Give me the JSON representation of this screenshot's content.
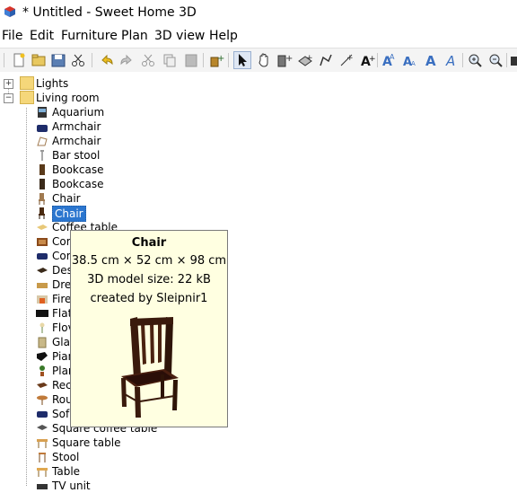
{
  "window": {
    "title": "* Untitled - Sweet Home 3D"
  },
  "menu": [
    "File",
    "Edit",
    "Furniture",
    "Plan",
    "3D view",
    "Help"
  ],
  "toolbar": {
    "icons": [
      "new-home-icon",
      "open-icon",
      "save-icon",
      "cut-tool-icon",
      "undo-icon",
      "redo-icon",
      "cut-icon",
      "copy-icon",
      "paste-icon",
      "add-furniture-icon",
      "select-mode-icon",
      "pan-mode-icon",
      "create-walls-icon",
      "create-rooms-icon",
      "create-polylines-icon",
      "create-dimensions-icon",
      "add-text-icon",
      "increase-text-size-icon",
      "decrease-text-size-icon",
      "bold-text-icon",
      "italic-text-icon",
      "zoom-in-icon",
      "zoom-out-icon",
      "create-photo-icon"
    ]
  },
  "tree": {
    "categories": [
      {
        "label": "Lights",
        "expanded": false
      },
      {
        "label": "Living room",
        "expanded": true
      }
    ],
    "items": [
      {
        "label": "Aquarium",
        "icon": "aquarium-icon"
      },
      {
        "label": "Armchair",
        "icon": "armchair-icon"
      },
      {
        "label": "Armchair",
        "icon": "armchair-icon"
      },
      {
        "label": "Bar stool",
        "icon": "bar-stool-icon"
      },
      {
        "label": "Bookcase",
        "icon": "bookcase-icon"
      },
      {
        "label": "Bookcase",
        "icon": "bookcase-icon"
      },
      {
        "label": "Chair",
        "icon": "chair-icon"
      },
      {
        "label": "Chair",
        "icon": "chair-icon",
        "selected": true
      },
      {
        "label": "Coffee table",
        "icon": "coffee-table-icon"
      },
      {
        "label": "Cor",
        "icon": "corner-icon"
      },
      {
        "label": "Cor",
        "icon": "corner-sofa-icon"
      },
      {
        "label": "Des",
        "icon": "desk-icon"
      },
      {
        "label": "Dre",
        "icon": "dresser-icon"
      },
      {
        "label": "Fire",
        "icon": "fireplace-icon"
      },
      {
        "label": "Flat",
        "icon": "flat-tv-icon"
      },
      {
        "label": "Flov",
        "icon": "flower-icon"
      },
      {
        "label": "Gla",
        "icon": "glass-icon"
      },
      {
        "label": "Pian",
        "icon": "piano-icon"
      },
      {
        "label": "Plan",
        "icon": "plant-icon"
      },
      {
        "label": "Rec",
        "icon": "rectangular-table-icon"
      },
      {
        "label": "Rou",
        "icon": "round-table-icon"
      },
      {
        "label": "Sof",
        "icon": "sofa-icon"
      },
      {
        "label": "Square coffee table",
        "icon": "square-coffee-table-icon"
      },
      {
        "label": "Square table",
        "icon": "square-table-icon"
      },
      {
        "label": "Stool",
        "icon": "stool-icon"
      },
      {
        "label": "Table",
        "icon": "table-icon"
      },
      {
        "label": "TV unit",
        "icon": "tv-unit-icon"
      }
    ]
  },
  "tooltip": {
    "name": "Chair",
    "dimensions": "38.5 cm × 52 cm × 98 cm",
    "model_size": "3D model size: 22 kB",
    "creator": "created by Sleipnir1",
    "image_icon": "chair-3d-preview"
  }
}
